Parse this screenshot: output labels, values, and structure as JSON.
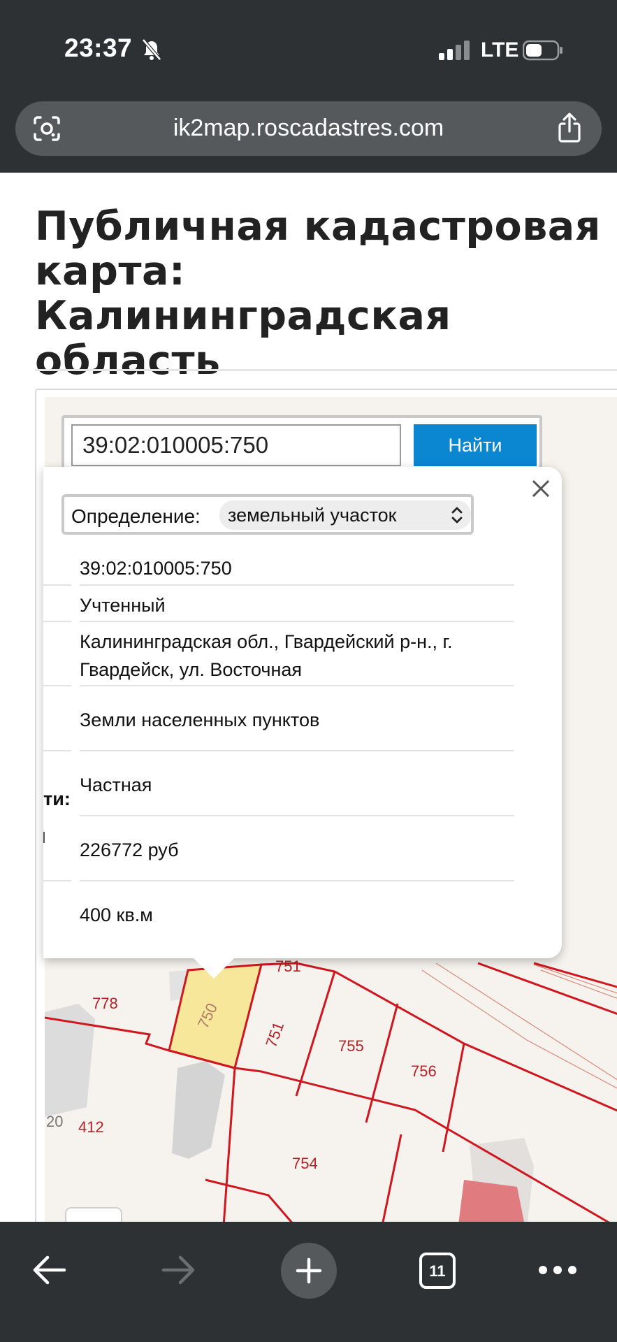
{
  "status_bar": {
    "time": "23:37",
    "network": "LTE"
  },
  "browser": {
    "url": "ik2map.roscadastres.com",
    "tab_count": "11"
  },
  "page": {
    "title": "Публичная кадастровая карта: Калининградская область"
  },
  "search": {
    "value": "39:02:010005:750",
    "button_label": "Найти"
  },
  "popup": {
    "definition_label": "Определение:",
    "definition_value": "земельный участок",
    "cut_label": "ти:",
    "rows": [
      {
        "text": "39:02:010005:750"
      },
      {
        "text": "Учтенный"
      },
      {
        "text": "Калининградская обл., Гвардейский р-н., г. Гвардейск, ул. Восточная"
      },
      {
        "text": "Земли населенных пунктов"
      },
      {
        "text": "Частная"
      },
      {
        "text": "226772 руб"
      },
      {
        "text": "400 кв.м"
      }
    ]
  },
  "map": {
    "parcel_labels": [
      "778",
      "750",
      "751",
      "755",
      "756",
      "20",
      "412",
      "754",
      "751"
    ],
    "highlight_color": "#f7e79a",
    "boundary_color": "#d0161e"
  }
}
